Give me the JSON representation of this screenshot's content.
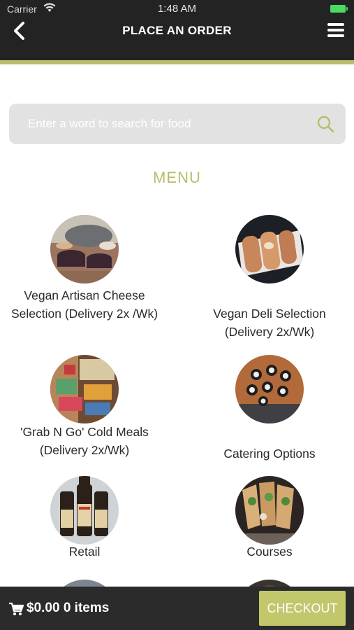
{
  "status_bar": {
    "carrier": "Carrier",
    "time": "1:48 AM"
  },
  "header": {
    "title": "PLACE AN ORDER"
  },
  "search": {
    "placeholder": "Enter a word to search for food"
  },
  "menu": {
    "heading": "MENU",
    "items": [
      {
        "label": "Vegan Artisan Cheese Selection (Delivery 2x /Wk)"
      },
      {
        "label": "Vegan Deli Selection (Delivery 2x/Wk)"
      },
      {
        "label": "'Grab N Go' Cold Meals (Delivery 2x/Wk)"
      },
      {
        "label": "Catering Options"
      },
      {
        "label": "Retail"
      },
      {
        "label": "Courses"
      }
    ]
  },
  "cart": {
    "summary": "$0.00 0 items",
    "checkout_label": "CHECKOUT"
  },
  "colors": {
    "accent": "#b9bd6a",
    "header_bg": "#232323",
    "checkout_bg": "#c3c76c"
  }
}
